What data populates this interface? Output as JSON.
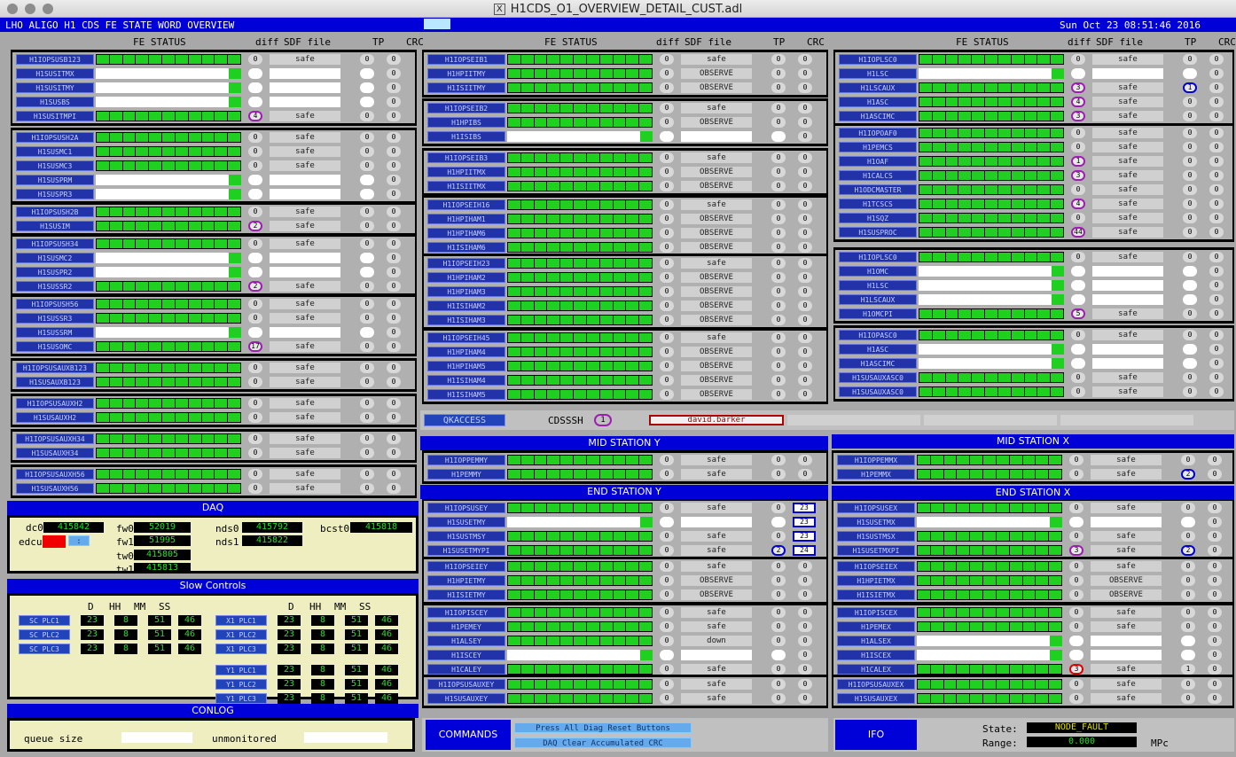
{
  "window": {
    "title": "H1CDS_O1_OVERVIEW_DETAIL_CUST.adl"
  },
  "header": {
    "title": "LHO ALIGO H1 CDS FE STATE WORD OVERVIEW",
    "datetime": "Sun Oct 23 08:51:46 2016"
  },
  "cols": {
    "fe": "FE STATUS",
    "diff": "diff",
    "sdf": "SDF file",
    "tp": "TP",
    "crc": "CRC"
  },
  "vals": {
    "safe": "safe",
    "observe": "OBSERVE",
    "down": "down",
    "zero": "0"
  },
  "left_groups": [
    [
      "H1IOPSUSB123",
      "H1SUSITMX",
      "H1SUSITMY",
      "H1SUSBS",
      "H1SUSITMPI"
    ],
    [
      "H1IOPSUSH2A",
      "H1SUSMC1",
      "H1SUSMC3",
      "H1SUSPRM",
      "H1SUSPR3"
    ],
    [
      "H1IOPSUSH2B",
      "H1SUSIM"
    ],
    [
      "H1IOPSUSH34",
      "H1SUSMC2",
      "H1SUSPR2",
      "H1SUSSR2"
    ],
    [
      "H1IOPSUSH56",
      "H1SUSSR3",
      "H1SUSSRM",
      "H1SUSOMC"
    ],
    [
      "H1IOPSUSAUXB123",
      "H1SUSAUXB123"
    ],
    [
      "H1IOPSUSAUXH2",
      "H1SUSAUXH2"
    ],
    [
      "H1IOPSUSAUXH34",
      "H1SUSAUXH34"
    ],
    [
      "H1IOPSUSAUXH56",
      "H1SUSAUXH56"
    ]
  ],
  "mid_groups": [
    [
      "H1IOPSEIB1",
      "H1HPIITMY",
      "H1ISIITMY"
    ],
    [
      "H1IOPSEIB2",
      "H1HPIBS",
      "H1ISIBS"
    ],
    [
      "H1IOPSEIB3",
      "H1HPIITMX",
      "H1ISIITMX"
    ],
    [
      "H1IOPSEIH16",
      "H1HPIHAM1",
      "H1HPIHAM6",
      "H1ISIHAM6"
    ],
    [
      "H1IOPSEIH23",
      "H1HPIHAM2",
      "H1HPIHAM3",
      "H1ISIHAM2",
      "H1ISIHAM3"
    ],
    [
      "H1IOPSEIH45",
      "H1HPIHAM4",
      "H1HPIHAM5",
      "H1ISIHAM4",
      "H1ISIHAM5"
    ]
  ],
  "right_groups": [
    [
      "H1IOPLSC0",
      "H1LSC",
      "H1LSCAUX",
      "H1ASC",
      "H1ASCIMC"
    ],
    [
      "H1IOPOAF0",
      "H1PEMCS",
      "H1OAF",
      "H1CALCS",
      "H1ODCMASTER",
      "H1TCSCS",
      "H1SQZ",
      "H1SUSPROC"
    ],
    [
      "H1IOPLSC0",
      "H1OMC",
      "H1LSC",
      "H1LSCAUX",
      "H1OMCPI"
    ],
    [
      "H1IOPASC0",
      "H1ASC",
      "H1ASCIMC",
      "H1SUSAUXASC0",
      "H1SUSAUXASC0"
    ]
  ],
  "qkaccess": {
    "button": "QKACCESS",
    "label": "CDSSSH",
    "count": "1",
    "user": "david.barker"
  },
  "mid_y": {
    "title": "MID STATION Y",
    "rows": [
      "H1IOPPEMMY",
      "H1PEMMY"
    ]
  },
  "mid_x": {
    "title": "MID STATION X",
    "rows": [
      "H1IOPPEMMX",
      "H1PEMMX"
    ]
  },
  "end_y": {
    "title": "END STATION Y",
    "groups": [
      [
        "H1IOPSUSEY",
        "H1SUSETMY",
        "H1SUSTMSY",
        "H1SUSETMYPI"
      ],
      [
        "H1IOPSEIEY",
        "H1HPIETMY",
        "H1ISIETMY"
      ],
      [
        "H1IOPISCEY",
        "H1PEMEY",
        "H1ALSEY",
        "H1ISCEY",
        "H1CALEY"
      ],
      [
        "H1IOPSUSAUXEY",
        "H1SUSAUXEY"
      ]
    ],
    "crc": [
      "23",
      "23",
      "23",
      "24"
    ]
  },
  "end_x": {
    "title": "END STATION X",
    "groups": [
      [
        "H1IOPSUSEX",
        "H1SUSETMX",
        "H1SUSTMSX",
        "H1SUSETMXPI"
      ],
      [
        "H1IOPSEIEX",
        "H1HPIETMX",
        "H1ISIETMX"
      ],
      [
        "H1IOPISCEX",
        "H1PEMEX",
        "H1ALSEX",
        "H1ISCEX",
        "H1CALEX"
      ],
      [
        "H1IOPSUSAUXEX",
        "H1SUSAUXEX"
      ]
    ]
  },
  "daq": {
    "title": "DAQ",
    "dc0_label": "dc0",
    "dc0": "415842",
    "edcu_label": "edcu",
    "fw0_label": "fw0",
    "fw0": "52019",
    "fw1_label": "fw1",
    "fw1": "51995",
    "tw0_label": "tw0",
    "tw0": "415805",
    "tw1_label": "tw1",
    "tw1": "415813",
    "nds0_label": "nds0",
    "nds0": "415792",
    "nds1_label": "nds1",
    "nds1": "415822",
    "bcst0_label": "bcst0",
    "bcst0": "415818"
  },
  "slow": {
    "title": "Slow Controls",
    "h": [
      "D",
      "HH",
      "MM",
      "SS"
    ],
    "left": [
      {
        "name": "SC PLC1",
        "v": [
          "23",
          "8",
          "51",
          "46"
        ]
      },
      {
        "name": "SC PLC2",
        "v": [
          "23",
          "8",
          "51",
          "46"
        ]
      },
      {
        "name": "SC PLC3",
        "v": [
          "23",
          "8",
          "51",
          "46"
        ]
      }
    ],
    "right": [
      {
        "name": "X1 PLC1",
        "v": [
          "23",
          "8",
          "51",
          "46"
        ]
      },
      {
        "name": "X1 PLC2",
        "v": [
          "23",
          "8",
          "51",
          "46"
        ]
      },
      {
        "name": "X1 PLC3",
        "v": [
          "23",
          "8",
          "51",
          "46"
        ]
      },
      {
        "name": "Y1 PLC1",
        "v": [
          "23",
          "8",
          "51",
          "46"
        ]
      },
      {
        "name": "Y1 PLC2",
        "v": [
          "23",
          "8",
          "51",
          "46"
        ]
      },
      {
        "name": "Y1 PLC3",
        "v": [
          "23",
          "8",
          "51",
          "46"
        ]
      }
    ]
  },
  "conlog": {
    "title": "CONLOG",
    "queue_label": "queue size",
    "unmon_label": "unmonitored"
  },
  "commands": {
    "title": "COMMANDS",
    "btn1": "Press All Diag Reset Buttons",
    "btn2": "DAQ Clear Accumulated CRC"
  },
  "ifo": {
    "title": "IFO",
    "state_label": "State:",
    "state": "NODE_FAULT",
    "range_label": "Range:",
    "range": "0.000",
    "unit": "MPc"
  },
  "colors": {
    "accent": "#0000d8",
    "panel": "#eeeec0",
    "ok": "#20d020"
  }
}
